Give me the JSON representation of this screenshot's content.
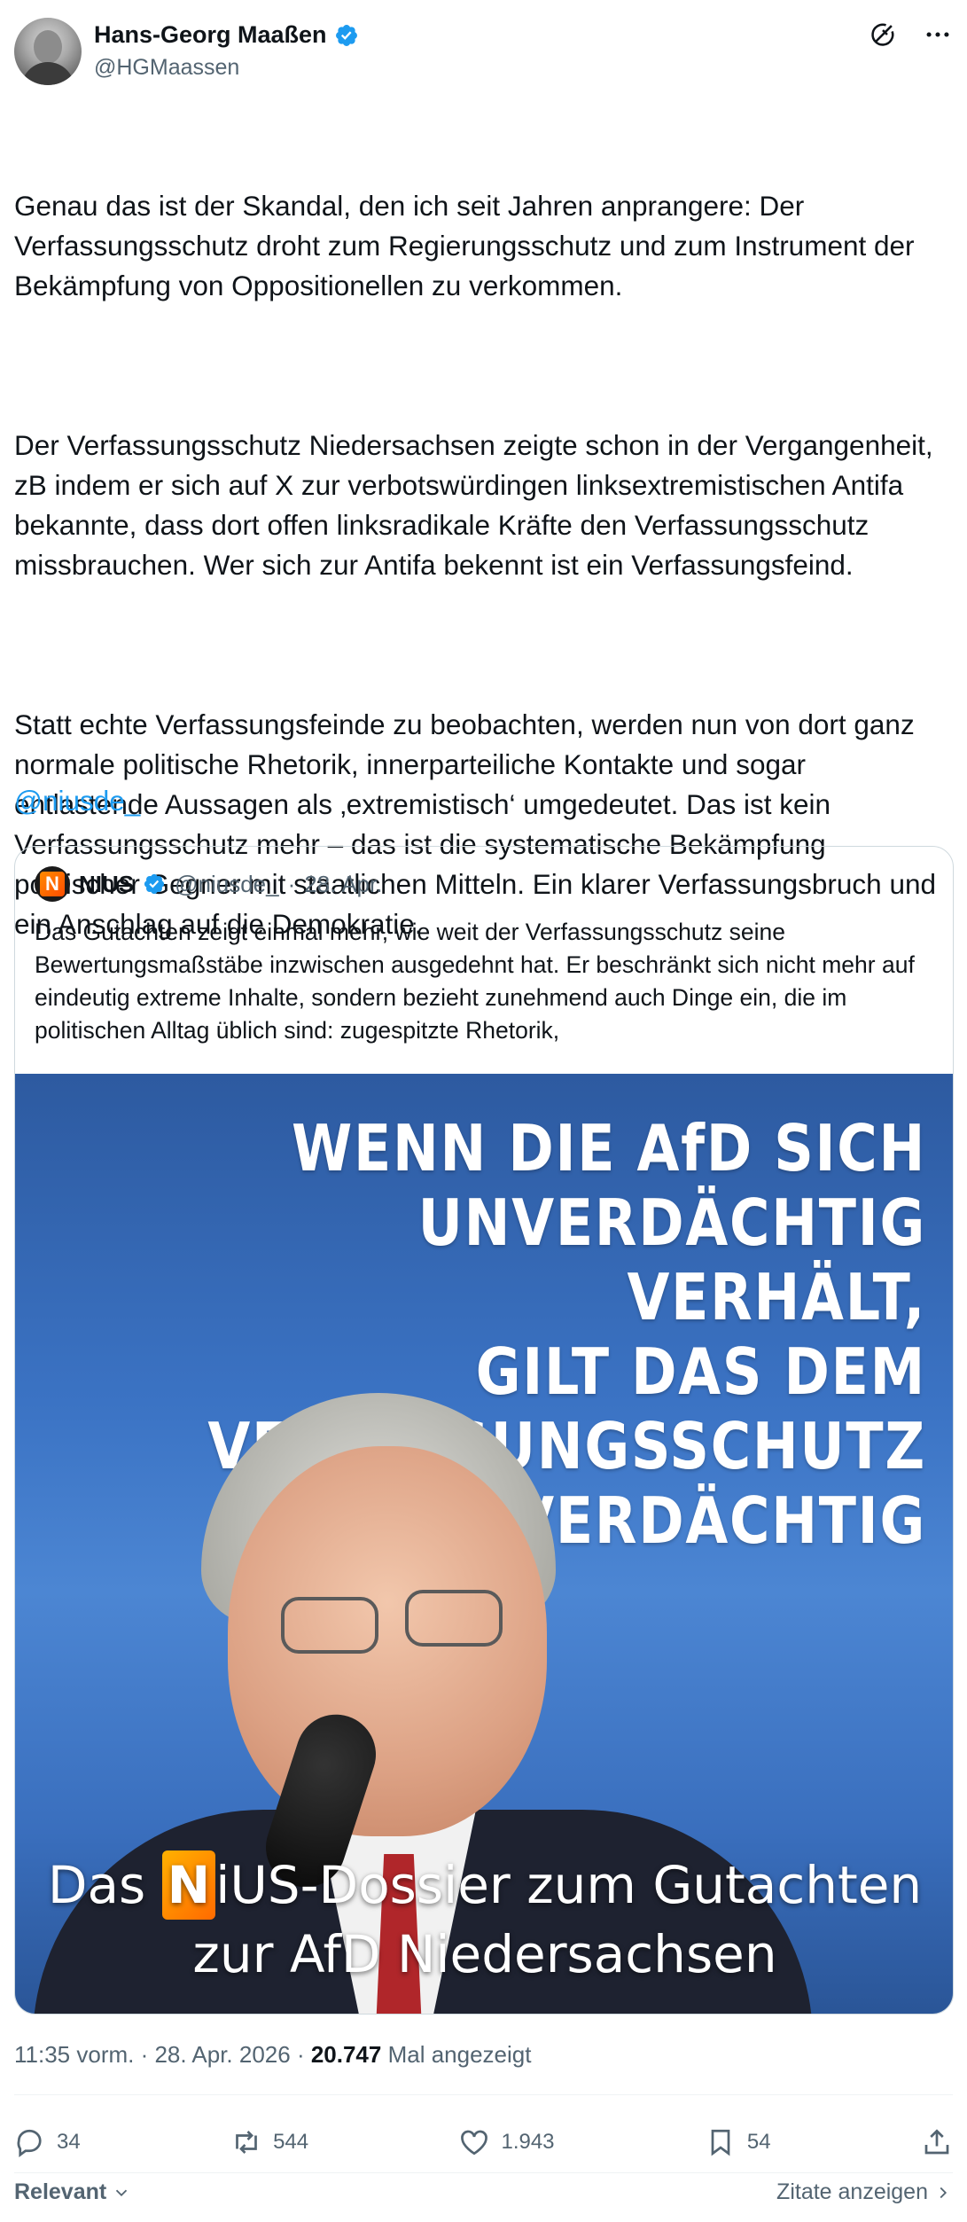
{
  "author": {
    "name": "Hans-Georg Maaßen",
    "handle": "@HGMaassen"
  },
  "tweet": {
    "paragraphs": [
      "Genau das ist der Skandal, den ich seit Jahren anprangere: Der Verfassungsschutz droht zum Regierungsschutz und zum Instrument der Bekämpfung von Oppositionellen zu verkommen.",
      "Der Verfassungsschutz Niedersachsen zeigte schon in der Vergangenheit, zB indem er sich auf X zur verbotswürdingen linksextremistischen Antifa bekannte, dass dort offen linksradikale Kräfte den Verfassungsschutz missbrauchen. Wer sich zur Antifa bekennt ist ein Verfassungsfeind.",
      "Statt echte Verfassungsfeinde zu beobachten, werden nun von dort ganz normale politische Rhetorik, innerparteiliche Kontakte und sogar entlastende Aussagen als ‚extremistisch‘ umgedeutet. Das ist kein Verfassungsschutz mehr – das ist die systematische Bekämpfung politischer Gegner mit staatlichen Mitteln. Ein klarer Verfassungsbruch und ein Anschlag auf die Demokratie."
    ],
    "mention": "@niusde_"
  },
  "quote": {
    "logo_letter": "N",
    "name": "NIUS",
    "handle": "@niusde_",
    "separator": "·",
    "date": "28. Apr.",
    "text": "Das Gutachten zeigt einmal mehr, wie weit der Verfassungsschutz seine Bewertungsmaßstäbe inzwischen ausgedehnt hat. Er beschränkt sich nicht mehr auf eindeutig extreme Inhalte, sondern bezieht zunehmend auch Dinge ein, die im politischen Alltag üblich sind: zugespitzte Rhetorik,",
    "image": {
      "headline": [
        "WENN DIE AfD SICH",
        "UNVERDÄCHTIG VERHÄLT,",
        "GILT DAS DEM",
        "VERFASSUNGSSCHUTZ",
        "ALS VERDÄCHTIG"
      ],
      "banner_prefix": "Das ",
      "banner_badge": "N",
      "banner_brand": "iUS",
      "banner_line1_rest": "-Dossier zum Gutachten",
      "banner_line2": "zur AfD Niedersachsen"
    }
  },
  "meta": {
    "time": "11:35 vorm.",
    "separator": " · ",
    "date": "28. Apr. 2026",
    "views": "20.747",
    "views_label": " Mal angezeigt"
  },
  "actions": {
    "replies": "34",
    "reposts": "544",
    "likes": "1.943",
    "bookmarks": "54"
  },
  "footer": {
    "sort_label": "Relevant",
    "quotes_link": "Zitate anzeigen"
  },
  "icons": [
    "grok-icon",
    "more-icon",
    "verified-badge-icon",
    "reply-icon",
    "repost-icon",
    "like-icon",
    "bookmark-icon",
    "share-icon",
    "chevron-down-icon",
    "chevron-right-icon"
  ],
  "colors": {
    "link": "#1d9bf0",
    "muted": "#536471",
    "text": "#0f1419",
    "verified": "#1d9bf0"
  }
}
